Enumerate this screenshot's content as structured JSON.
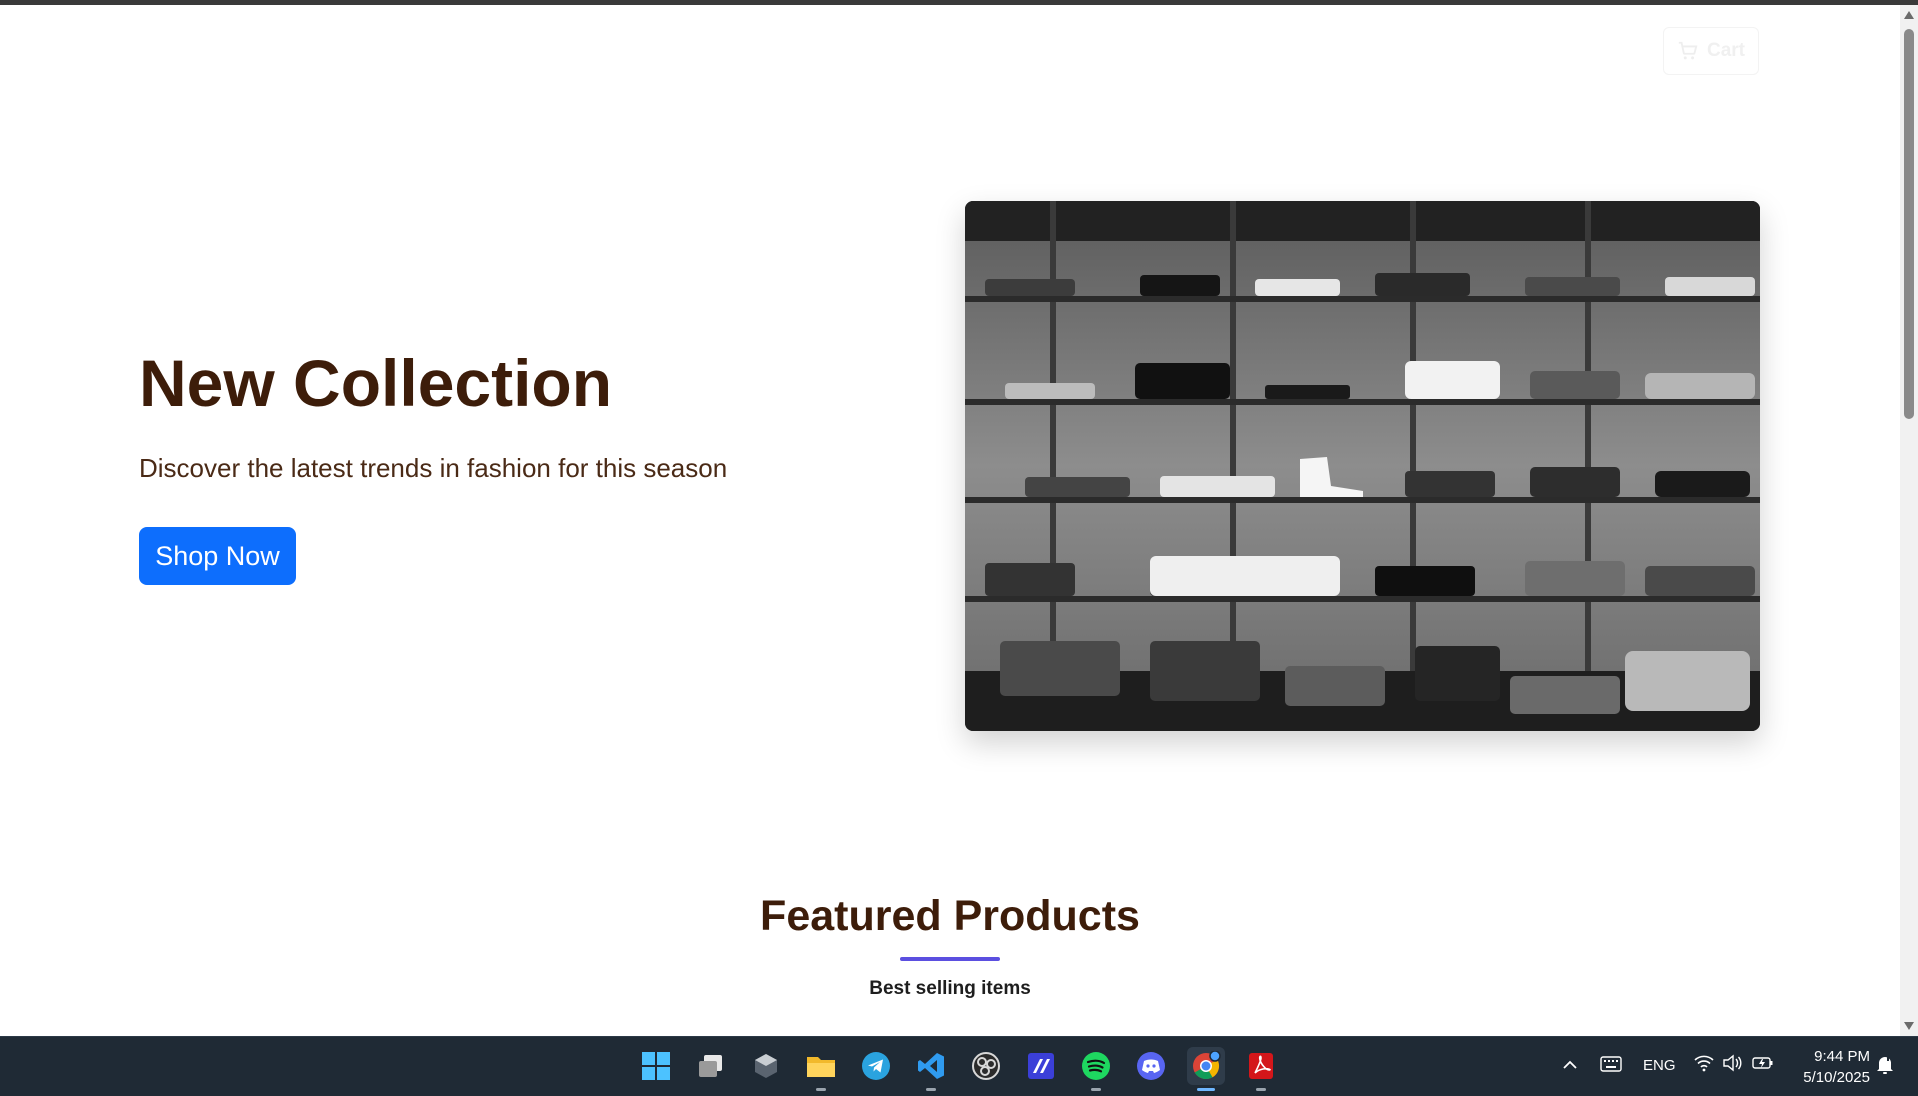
{
  "header": {
    "cart_label": "Cart"
  },
  "hero": {
    "title": "New Collection",
    "subtitle": "Discover the latest trends in fashion for this season",
    "cta_label": "Shop Now"
  },
  "featured": {
    "title": "Featured Products",
    "subtitle": "Best selling items"
  },
  "taskbar": {
    "apps": [
      "start-icon",
      "task-view-icon",
      "3d-app-icon",
      "file-explorer-icon",
      "telegram-icon",
      "vscode-icon",
      "obs-icon",
      "code-editor-icon",
      "spotify-icon",
      "discord-icon",
      "chrome-icon",
      "acrobat-icon"
    ],
    "language": "ENG",
    "time": "9:44 PM",
    "date": "5/10/2025"
  },
  "colors": {
    "heading": "#3d1d0a",
    "primary_button": "#0d6efd",
    "accent_underline": "#5b4fe0",
    "taskbar_bg": "#1f2a35"
  }
}
